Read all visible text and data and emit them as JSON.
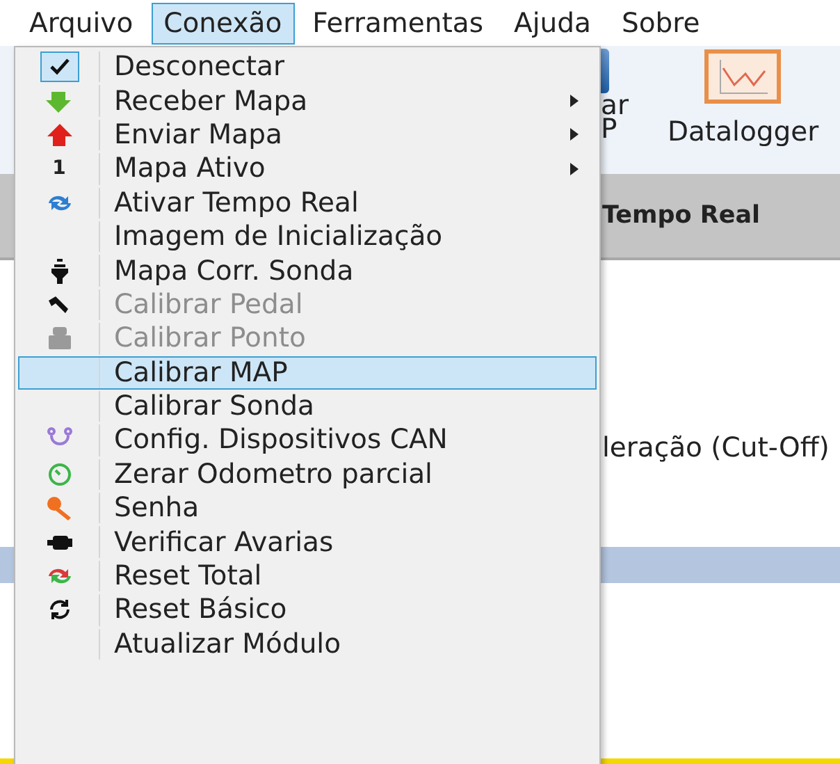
{
  "menu_bar": [
    {
      "label": "Arquivo",
      "selected": false
    },
    {
      "label": "Conexão",
      "selected": true
    },
    {
      "label": "Ferramentas",
      "selected": false
    },
    {
      "label": "Ajuda",
      "selected": false
    },
    {
      "label": "Sobre",
      "selected": false
    }
  ],
  "toolbar": {
    "partial_button": [
      "ar",
      "P"
    ],
    "datalogger": "Datalogger"
  },
  "header": {
    "title": "Tempo Real"
  },
  "content": {
    "text": "leração (Cut-Off)"
  },
  "dropdown": [
    {
      "label": "Desconectar",
      "checked": true,
      "disabled": false,
      "selected": false,
      "submenu": false
    },
    {
      "label": "Receber Mapa",
      "checked": false,
      "disabled": false,
      "selected": false,
      "submenu": true
    },
    {
      "label": "Enviar Mapa",
      "checked": false,
      "disabled": false,
      "selected": false,
      "submenu": true
    },
    {
      "label": "Mapa Ativo",
      "badge": "1",
      "checked": false,
      "disabled": false,
      "selected": false,
      "submenu": true
    },
    {
      "label": "Ativar Tempo Real",
      "checked": false,
      "disabled": false,
      "selected": false,
      "submenu": false
    },
    {
      "label": "Imagem de Inicialização",
      "checked": false,
      "disabled": false,
      "selected": false,
      "submenu": false
    },
    {
      "label": "Mapa Corr. Sonda",
      "checked": false,
      "disabled": false,
      "selected": false,
      "submenu": false
    },
    {
      "label": "Calibrar Pedal",
      "checked": false,
      "disabled": true,
      "selected": false,
      "submenu": false
    },
    {
      "label": "Calibrar Ponto",
      "checked": false,
      "disabled": true,
      "selected": false,
      "submenu": false
    },
    {
      "label": "Calibrar MAP",
      "checked": false,
      "disabled": false,
      "selected": true,
      "submenu": false
    },
    {
      "label": "Calibrar Sonda",
      "checked": false,
      "disabled": false,
      "selected": false,
      "submenu": false
    },
    {
      "label": "Config. Dispositivos CAN",
      "checked": false,
      "disabled": false,
      "selected": false,
      "submenu": false
    },
    {
      "label": "Zerar Odometro parcial",
      "checked": false,
      "disabled": false,
      "selected": false,
      "submenu": false
    },
    {
      "label": "Senha",
      "checked": false,
      "disabled": false,
      "selected": false,
      "submenu": false
    },
    {
      "label": "Verificar Avarias",
      "checked": false,
      "disabled": false,
      "selected": false,
      "submenu": false
    },
    {
      "label": "Reset Total",
      "checked": false,
      "disabled": false,
      "selected": false,
      "submenu": false
    },
    {
      "label": "Reset Básico",
      "checked": false,
      "disabled": false,
      "selected": false,
      "submenu": false
    },
    {
      "label": "Atualizar Módulo",
      "checked": false,
      "disabled": false,
      "selected": false,
      "submenu": false
    }
  ]
}
